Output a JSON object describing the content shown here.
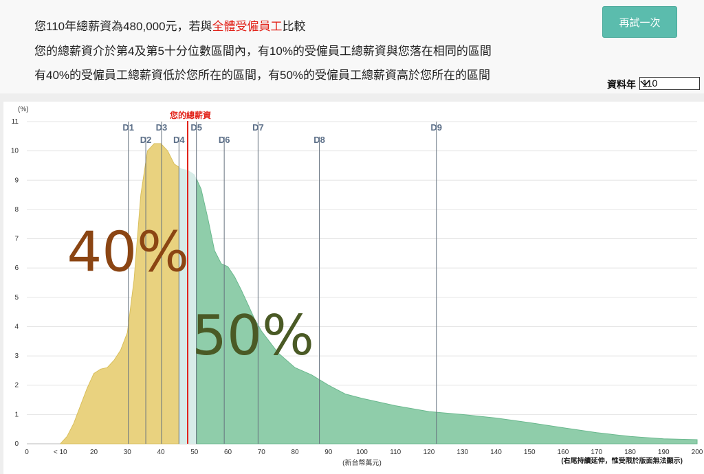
{
  "header": {
    "line1_pre": "您110年總薪資為480,000元，若與",
    "line1_hl": "全體受僱員工",
    "line1_post": "比較",
    "line2": "您的總薪資介於第4及第5十分位數區間內，有10%的受僱員工總薪資與您落在相同的區間",
    "line3": "有40%的受僱員工總薪資低於您所在的區間，有50%的受僱員工總薪資高於您所在的區間"
  },
  "retry_label": "再試一次",
  "year": {
    "label": "資料年",
    "value": "110"
  },
  "colors": {
    "accent_red": "#e2231a",
    "button": "#5bbcad",
    "below": "#e9d27f",
    "same": "#d7ece8",
    "above": "#8fcdaa",
    "pct40": "#8b4513",
    "pct50": "#4a5a25"
  },
  "chart_data": {
    "type": "area",
    "title": "",
    "y_unit": "(%)",
    "xlabel": "(新台幣萬元)",
    "x_note": "(右尾持續延伸，惟受限於版面無法顯示)",
    "xlim": [
      0,
      200
    ],
    "ylim": [
      0,
      11
    ],
    "x_ticks": [
      {
        "v": 0,
        "t": "0"
      },
      {
        "v": 10,
        "t": "< 10"
      },
      {
        "v": 20,
        "t": "20"
      },
      {
        "v": 30,
        "t": "30"
      },
      {
        "v": 40,
        "t": "40"
      },
      {
        "v": 50,
        "t": "50"
      },
      {
        "v": 60,
        "t": "60"
      },
      {
        "v": 70,
        "t": "70"
      },
      {
        "v": 80,
        "t": "80"
      },
      {
        "v": 90,
        "t": "90"
      },
      {
        "v": 100,
        "t": "100"
      },
      {
        "v": 110,
        "t": "110"
      },
      {
        "v": 120,
        "t": "120"
      },
      {
        "v": 130,
        "t": "130"
      },
      {
        "v": 140,
        "t": "140"
      },
      {
        "v": 150,
        "t": "150"
      },
      {
        "v": 160,
        "t": "160"
      },
      {
        "v": 170,
        "t": "170"
      },
      {
        "v": 180,
        "t": "180"
      },
      {
        "v": 190,
        "t": "190"
      },
      {
        "v": 200,
        "t": "200"
      }
    ],
    "y_ticks": [
      0,
      1,
      2,
      3,
      4,
      5,
      6,
      7,
      8,
      9,
      10,
      11
    ],
    "series": [
      {
        "x": [
          10,
          12,
          14,
          16,
          18,
          20,
          22,
          24,
          26,
          28,
          30,
          32,
          34,
          36,
          38,
          40,
          42,
          44,
          46,
          48,
          50,
          52,
          54,
          56,
          58,
          60,
          62,
          64,
          66,
          68,
          70,
          75,
          80,
          85,
          90,
          95,
          100,
          110,
          120,
          130,
          140,
          150,
          160,
          170,
          180,
          190,
          200
        ],
        "values": [
          0,
          0.25,
          0.7,
          1.3,
          1.9,
          2.4,
          2.55,
          2.6,
          2.85,
          3.2,
          3.8,
          5.6,
          8.5,
          10.0,
          10.25,
          10.25,
          10.0,
          9.55,
          9.4,
          9.35,
          9.2,
          8.7,
          7.7,
          6.6,
          6.15,
          6.05,
          5.7,
          5.25,
          4.75,
          4.25,
          3.85,
          3.1,
          2.6,
          2.35,
          2.0,
          1.7,
          1.55,
          1.3,
          1.1,
          1.0,
          0.88,
          0.72,
          0.55,
          0.38,
          0.25,
          0.17,
          0.14
        ]
      }
    ],
    "your_salary": {
      "label": "您的總薪資",
      "x": 48
    },
    "deciles": [
      {
        "label": "D1",
        "x": 30.3,
        "row": 1
      },
      {
        "label": "D2",
        "x": 35.5,
        "row": 2
      },
      {
        "label": "D3",
        "x": 40.2,
        "row": 1
      },
      {
        "label": "D4",
        "x": 45.4,
        "row": 2
      },
      {
        "label": "D5",
        "x": 50.6,
        "row": 1
      },
      {
        "label": "D6",
        "x": 58.9,
        "row": 2
      },
      {
        "label": "D7",
        "x": 69.0,
        "row": 1
      },
      {
        "label": "D8",
        "x": 87.3,
        "row": 2
      },
      {
        "label": "D9",
        "x": 122.2,
        "row": 1
      }
    ],
    "annotations": {
      "below_pct": "40%",
      "above_pct": "50%"
    }
  }
}
